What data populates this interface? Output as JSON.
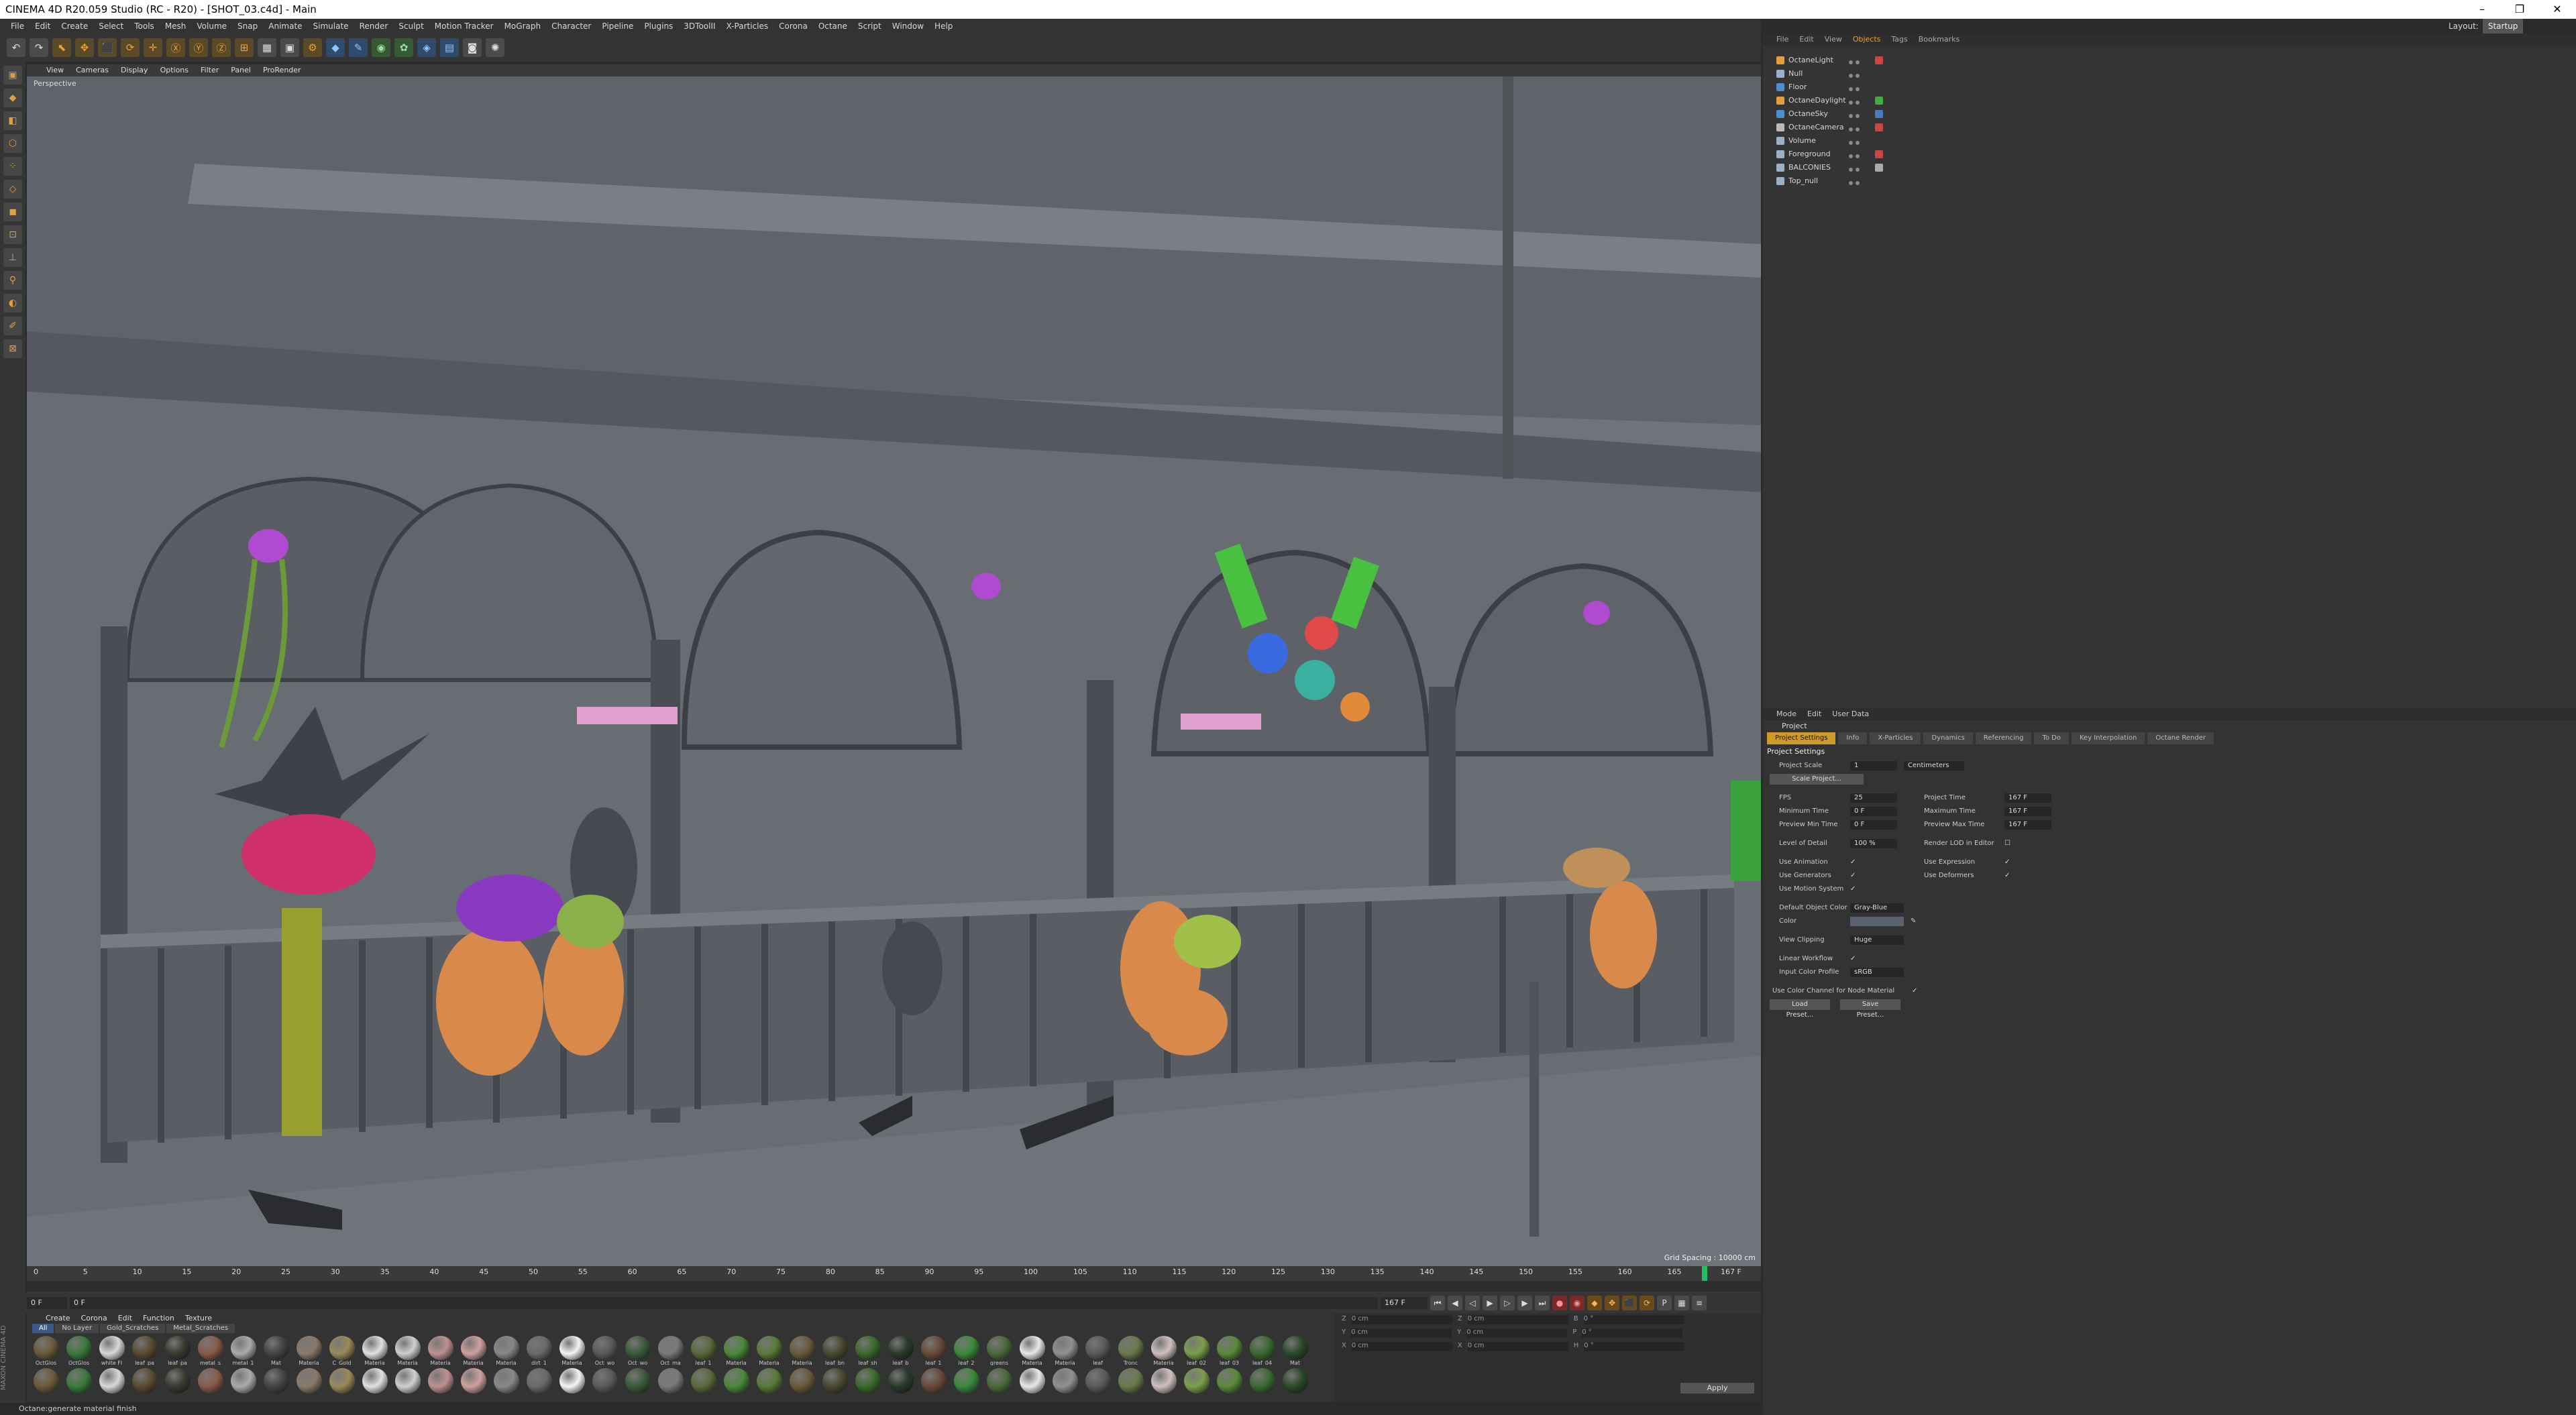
{
  "window": {
    "title": "CINEMA 4D R20.059 Studio (RC - R20) - [SHOT_03.c4d] - Main",
    "min": "–",
    "max": "❐",
    "close": "✕"
  },
  "menu": [
    "File",
    "Edit",
    "Create",
    "Select",
    "Tools",
    "Mesh",
    "Volume",
    "Snap",
    "Animate",
    "Simulate",
    "Render",
    "Sculpt",
    "Motion Tracker",
    "MoGraph",
    "Character",
    "Pipeline",
    "Plugins",
    "3DToolII",
    "X-Particles",
    "Corona",
    "Octane",
    "Script",
    "Window",
    "Help"
  ],
  "layout": {
    "label": "Layout:",
    "value": "Startup"
  },
  "viewport": {
    "menu": [
      "View",
      "Cameras",
      "Display",
      "Options",
      "Filter",
      "Panel",
      "ProRender"
    ],
    "label": "Perspective",
    "grid_spacing": "Grid Spacing : 10000 cm"
  },
  "timeline": {
    "ticks": [
      "0",
      "5",
      "10",
      "15",
      "20",
      "25",
      "30",
      "35",
      "40",
      "45",
      "50",
      "55",
      "60",
      "65",
      "70",
      "75",
      "80",
      "85",
      "90",
      "95",
      "100",
      "105",
      "110",
      "115",
      "120",
      "125",
      "130",
      "135",
      "140",
      "145",
      "150",
      "155",
      "160",
      "165"
    ],
    "end_label": "167 F",
    "current_frame": "0 F",
    "start_field": "0 F",
    "end_field": "167 F"
  },
  "materials": {
    "menu": [
      "Create",
      "Corona",
      "Edit",
      "Function",
      "Texture"
    ],
    "tabs": [
      "All",
      "No Layer",
      "Gold_Scratches",
      "Metal_Scratches"
    ],
    "swatches": [
      {
        "label": "OctGlos",
        "color": "#6a5a3a"
      },
      {
        "label": "OctGlos",
        "color": "#3a7a3a"
      },
      {
        "label": "white Fl",
        "color": "#d8d8d8"
      },
      {
        "label": "leaf_pa",
        "color": "#5a4a30"
      },
      {
        "label": "leaf_pa",
        "color": "#3a3a30"
      },
      {
        "label": "metal_s",
        "color": "#8a5a4a"
      },
      {
        "label": "metal_1",
        "color": "#aaaaaa"
      },
      {
        "label": "Mat",
        "color": "#444444"
      },
      {
        "label": "Materia",
        "color": "#8a7a6a"
      },
      {
        "label": "C_Gold",
        "color": "#9a8a5a"
      },
      {
        "label": "Materia",
        "color": "#e0e0e0"
      },
      {
        "label": "Materia",
        "color": "#cfcfcf"
      },
      {
        "label": "Materia",
        "color": "#c09090"
      },
      {
        "label": "Materia",
        "color": "#d0a0a0"
      },
      {
        "label": "Materia",
        "color": "#888888"
      },
      {
        "label": "dirt_1",
        "color": "#6a6a6a"
      },
      {
        "label": "Materia",
        "color": "#f4f4f4"
      },
      {
        "label": "Oct_wo",
        "color": "#5a5a5a"
      },
      {
        "label": "Oct_wo",
        "color": "#3a5a3a"
      },
      {
        "label": "Oct_ma",
        "color": "#7a7a7a"
      },
      {
        "label": "leaf_1",
        "color": "#5a6a3a"
      },
      {
        "label": "Materia",
        "color": "#4a8a3a"
      },
      {
        "label": "Materia",
        "color": "#5a7a3a"
      },
      {
        "label": "Materia",
        "color": "#6a5a3a"
      },
      {
        "label": "leaf_bn",
        "color": "#4a4a30"
      },
      {
        "label": "leaf_sh",
        "color": "#3a6a2a"
      },
      {
        "label": "leaf_b",
        "color": "#2a3a2a"
      },
      {
        "label": "leaf_1",
        "color": "#6a4a3a"
      },
      {
        "label": "leaf_2",
        "color": "#3a8a3a"
      },
      {
        "label": "greens",
        "color": "#4a6a3a"
      },
      {
        "label": "Materia",
        "color": "#e8e8e8"
      },
      {
        "label": "Materia",
        "color": "#909090"
      },
      {
        "label": "leaf",
        "color": "#5a5a5a"
      },
      {
        "label": "Tronc",
        "color": "#6a7a4a"
      },
      {
        "label": "Materia",
        "color": "#d0c0c0"
      },
      {
        "label": "leaf_02",
        "color": "#7aa04a"
      },
      {
        "label": "leaf_03",
        "color": "#5a8a3a"
      },
      {
        "label": "leaf_04",
        "color": "#3a6a30"
      },
      {
        "label": "Mat",
        "color": "#2a4a2a"
      }
    ]
  },
  "coords": {
    "rows": [
      [
        "X",
        "0 cm",
        "X",
        "0 cm",
        "H",
        "0 °"
      ],
      [
        "Y",
        "0 cm",
        "Y",
        "0 cm",
        "P",
        "0 °"
      ],
      [
        "Z",
        "0 cm",
        "Z",
        "0 cm",
        "B",
        "0 °"
      ]
    ],
    "apply": "Apply"
  },
  "status": "Octane:generate material finish",
  "objects": {
    "tabs": [
      "File",
      "Edit",
      "View",
      "Objects",
      "Tags",
      "Bookmarks"
    ],
    "active_tab": "Objects",
    "items": [
      {
        "name": "OctaneLight",
        "icon": "#e0a040",
        "tag": "#cc4444"
      },
      {
        "name": "Null",
        "icon": "#9ab0c8",
        "tag": ""
      },
      {
        "name": "Floor",
        "icon": "#4a90d0",
        "tag": ""
      },
      {
        "name": "OctaneDaylight",
        "icon": "#e0a040",
        "tag": "#44aa44"
      },
      {
        "name": "OctaneSky",
        "icon": "#4a90d0",
        "tag": "#4a7ac0"
      },
      {
        "name": "OctaneCamera",
        "icon": "#bbbbbb",
        "tag": "#cc4444"
      },
      {
        "name": "Volume",
        "icon": "#9ab0c8",
        "tag": ""
      },
      {
        "name": "Foreground",
        "icon": "#9ab0c8",
        "tag": "#cc4444"
      },
      {
        "name": "BALCONIES",
        "icon": "#9ab0c8",
        "tag": "#aaaaaa"
      },
      {
        "name": "Top_null",
        "icon": "#9ab0c8",
        "tag": ""
      }
    ]
  },
  "attributes": {
    "menu": [
      "Mode",
      "Edit",
      "User Data"
    ],
    "object": "Project",
    "tabs": [
      "Project Settings",
      "Info",
      "X-Particles",
      "Dynamics",
      "Referencing",
      "To Do",
      "Key Interpolation",
      "Octane Render"
    ],
    "active_tab": "Project Settings",
    "section": "Project Settings",
    "project_scale_label": "Project Scale",
    "project_scale_value": "1",
    "project_scale_unit": "Centimeters",
    "scale_button": "Scale Project...",
    "fps_label": "FPS",
    "fps": "25",
    "project_time_label": "Project Time",
    "project_time": "167 F",
    "min_time_label": "Minimum Time",
    "min_time": "0 F",
    "max_time_label": "Maximum Time",
    "max_time": "167 F",
    "prev_min_label": "Preview Min Time",
    "prev_min": "0 F",
    "prev_max_label": "Preview Max Time",
    "prev_max": "167 F",
    "lod_label": "Level of Detail",
    "lod": "100 %",
    "render_lod_label": "Render LOD in Editor",
    "use_anim": "Use Animation",
    "use_expr": "Use Expression",
    "use_gen": "Use Generators",
    "use_def": "Use Deformers",
    "use_motion": "Use Motion System",
    "default_color_label": "Default Object Color",
    "default_color": "Gray-Blue",
    "color_label": "Color",
    "view_clip_label": "View Clipping",
    "view_clip": "Huge",
    "linear_label": "Linear Workflow",
    "input_profile_label": "Input Color Profile",
    "input_profile": "sRGB",
    "node_label": "Use Color Channel for Node Material",
    "load_preset": "Load Preset...",
    "save_preset": "Save Preset...",
    "check": "✓"
  }
}
